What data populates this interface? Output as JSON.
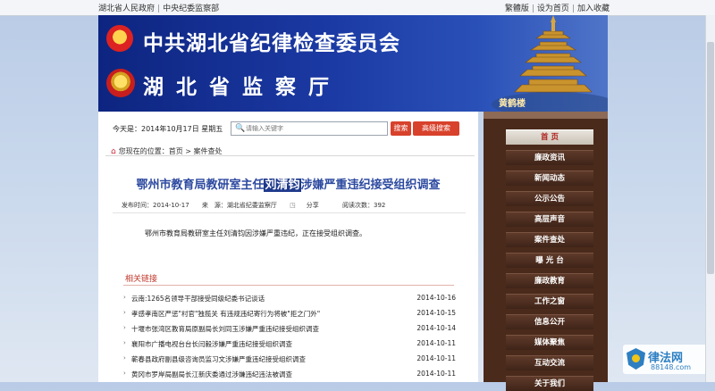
{
  "topbar": {
    "left_links": [
      "湖北省人民政府",
      "中央纪委监察部"
    ],
    "right_links": [
      "繁體版",
      "设为首页",
      "加入收藏"
    ]
  },
  "banner": {
    "title1": "中共湖北省纪律检查委员会",
    "title2": "湖北省监察厅",
    "tower_label": "黄鹤楼"
  },
  "header": {
    "date_text": "今天是：2014年10月17日 星期五",
    "search_placeholder": "请输入关键字",
    "search_button": "搜索",
    "advanced_search_button": "高级搜索"
  },
  "breadcrumb": {
    "prefix": "您现在的位置：",
    "items": [
      "首页",
      "案件查处"
    ],
    "separator": ">"
  },
  "article": {
    "title_before": "鄂州市教育局教研室主任",
    "title_highlight": "刘清钧",
    "title_after": "涉嫌严重违纪接受组织调查",
    "publish_time": "发布时间：2014-10-17",
    "source": "来　源：湖北省纪委监察厅",
    "share_label": "分享",
    "read_count": "阅读次数：392",
    "body": "鄂州市教育局教研室主任刘清钧因涉嫌严重违纪，正在接受组织调查。"
  },
  "related": {
    "title": "相关链接",
    "items": [
      {
        "title": "云南:1265名领导干部接受同级纪委书记谈话",
        "date": "2014-10-16"
      },
      {
        "title": "孝感孝南区严惩\"村官\"独揽关 有违规违纪寄行为将被\"拒之门外\"",
        "date": "2014-10-15"
      },
      {
        "title": "十堰市张湾区教育局原副局长刘同玉涉嫌严重违纪接受组织调查",
        "date": "2014-10-14"
      },
      {
        "title": "襄阳市广播电视台台长闫毅涉嫌严重违纪接受组织调查",
        "date": "2014-10-11"
      },
      {
        "title": "蕲春县政府副县级咨询员监习文涉嫌严重违纪接受组织调查",
        "date": "2014-10-11"
      },
      {
        "title": "黄冈市罗岸局副局长江新庆委通过涉嫌违纪违法被调查",
        "date": "2014-10-11"
      }
    ]
  },
  "sidenav": {
    "items": [
      "首 页",
      "廉政资讯",
      "新闻动态",
      "公示公告",
      "高层声音",
      "案件查处",
      "曝 光 台",
      "廉政教育",
      "工作之窗",
      "信息公开",
      "媒体聚焦",
      "互动交流",
      "关于我们"
    ]
  },
  "watermark": {
    "name": "律法网",
    "url": "88148.com"
  }
}
